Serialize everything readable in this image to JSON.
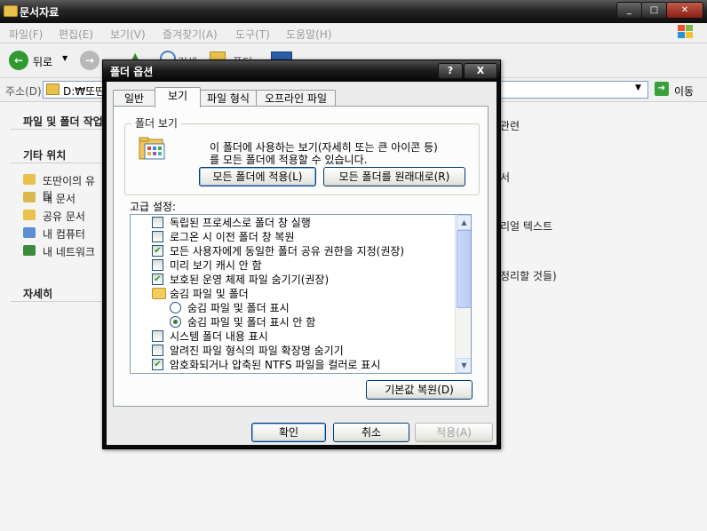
{
  "window": {
    "title": "문서자료",
    "caption_buttons": [
      "_",
      "□",
      "✕"
    ]
  },
  "menu": [
    "파일(F)",
    "편집(E)",
    "보기(V)",
    "즐겨찾기(A)",
    "도구(T)",
    "도움말(H)"
  ],
  "toolbar": {
    "back_label": "뒤로",
    "search_partial": "검색",
    "folders_partial": "폴더"
  },
  "address": {
    "label": "주소(D)",
    "value": "D:₩또딴",
    "go_label": "이동"
  },
  "left_pane": {
    "task_section": "파일 및 폴더 작업",
    "other_section": "기타 위치",
    "other_items": [
      "또딴이의 유틸",
      "내 문서",
      "공유 문서",
      "내 컴퓨터",
      "내 네트워크"
    ],
    "details_section": "자세히"
  },
  "right_partial": [
    "관련",
    "서",
    "리얼 텍스트",
    "정리할 것들)"
  ],
  "dialog": {
    "title": "폴더 옵션",
    "help_btn": "?",
    "close_btn": "X",
    "tabs": [
      "일반",
      "보기",
      "파일 형식",
      "오프라인 파일"
    ],
    "active_tab": "보기",
    "folder_view": {
      "label": "폴더 보기",
      "desc_line1": "이 폴더에 사용하는 보기(자세히 또는 큰 아이콘 등)",
      "desc_line2": "를 모든 폴더에  적용할 수 있습니다.",
      "apply_btn": "모든 폴더에 적용(L)",
      "reset_btn": "모든 폴더를 원래대로(R)"
    },
    "advanced_label": "고급 설정:",
    "settings": [
      {
        "type": "check",
        "checked": false,
        "text": "독립된 프로세스로 폴더 창 실행"
      },
      {
        "type": "check",
        "checked": false,
        "text": "로그온 시 이전 폴더 창 복원"
      },
      {
        "type": "check",
        "checked": true,
        "text": "모든 사용자에게 동일한 폴더 공유 권한을 지정(권장)"
      },
      {
        "type": "check",
        "checked": false,
        "text": "미리 보기 캐시 안 함"
      },
      {
        "type": "check",
        "checked": true,
        "text": "보호된 운영 체제 파일 숨기기(권장)"
      },
      {
        "type": "folder",
        "text": "숨김 파일 및 폴더"
      },
      {
        "type": "radio",
        "checked": false,
        "text": "숨김 파일 및 폴더 표시"
      },
      {
        "type": "radio",
        "checked": true,
        "text": "숨김 파일 및 폴더 표시 안 함"
      },
      {
        "type": "check",
        "checked": false,
        "text": "시스템 폴더 내용 표시"
      },
      {
        "type": "check",
        "checked": false,
        "text": "알려진 파일 형식의 파일 확장명 숨기기"
      },
      {
        "type": "check",
        "checked": true,
        "text": "암호화되거나 압축된 NTFS 파일을 컬러로 표시"
      }
    ],
    "restore_btn": "기본값 복원(D)",
    "ok_btn": "확인",
    "cancel_btn": "취소",
    "apply_btn": "적용(A)"
  }
}
